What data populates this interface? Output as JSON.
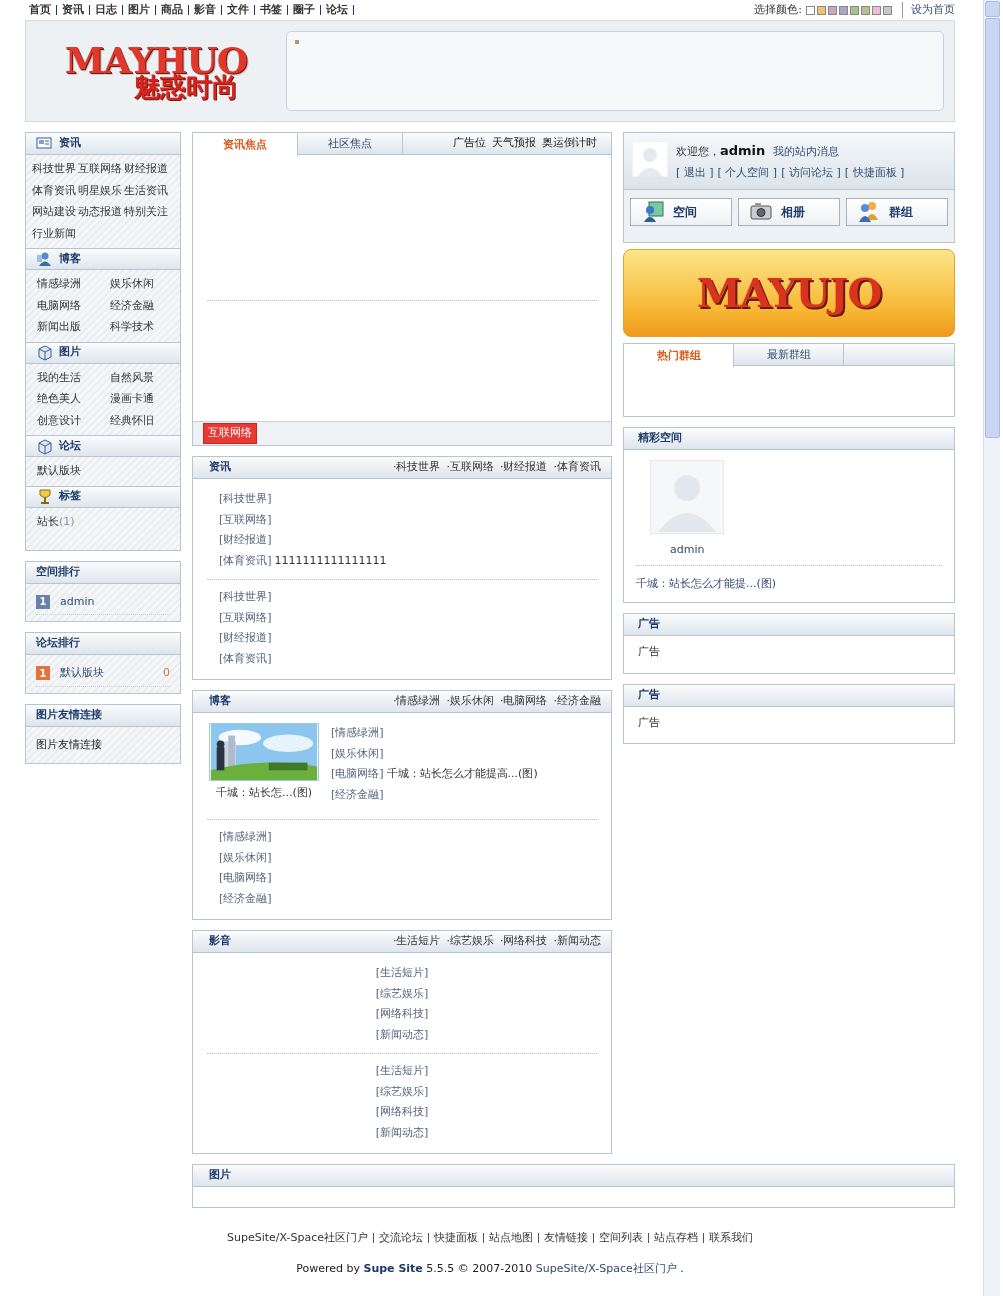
{
  "top_nav": {
    "links": [
      "首页",
      "资讯",
      "日志",
      "图片",
      "商品",
      "影音",
      "文件",
      "书签",
      "圈子",
      "论坛"
    ],
    "color_label": "选择颜色:",
    "swatches": [
      {
        "color": "#ffffff"
      },
      {
        "color": "#f4c06a"
      },
      {
        "color": "#c9a7bf"
      },
      {
        "color": "#a9a7c9"
      },
      {
        "color": "#a8c48a"
      },
      {
        "color": "#b9c08f"
      },
      {
        "color": "#f2bcd6"
      },
      {
        "color": "#c8c8c8"
      }
    ],
    "set_home": "设为首页"
  },
  "header": {
    "logo_latin": "MAYHUO",
    "logo_chinese": "魅惑时尚"
  },
  "sidebar": {
    "categories": [
      {
        "title": "资讯",
        "kind": "flow",
        "links": [
          "科技世界",
          "互联网络",
          "财经报道",
          "体育资讯",
          "明星娱乐",
          "生活资讯",
          "网站建设",
          "动态报道",
          "特别关注",
          "行业新闻"
        ]
      },
      {
        "title": "博客",
        "kind": "columns",
        "links": [
          "情感绿洲",
          "娱乐休闲",
          "电脑网络",
          "经济金融",
          "新闻出版",
          "科学技术"
        ]
      },
      {
        "title": "图片",
        "kind": "columns",
        "links": [
          "我的生活",
          "自然风景",
          "绝色美人",
          "漫画卡通",
          "创意设计",
          "经典怀旧"
        ]
      },
      {
        "title": "论坛",
        "kind": "columns",
        "links": [
          "默认版块"
        ]
      },
      {
        "title": "标签",
        "kind": "tags",
        "tags": [
          {
            "label": "站长",
            "count": "(1)"
          }
        ]
      }
    ],
    "boxes": [
      {
        "title": "空间排行",
        "items": [
          {
            "rank": "1",
            "name": "admin",
            "color": "#6b80a6"
          }
        ]
      },
      {
        "title": "论坛排行",
        "items": [
          {
            "rank": "1",
            "name": "默认版块",
            "count": "0",
            "color": "#e0743a"
          }
        ]
      },
      {
        "title": "图片友情连接",
        "text": "图片友情连接"
      }
    ]
  },
  "focus": {
    "tabs": [
      {
        "label": "资讯焦点",
        "selected": true
      },
      {
        "label": "社区焦点",
        "selected": false
      }
    ],
    "extras": [
      "广告位",
      "天气预报",
      "奥运倒计时"
    ],
    "tag": "互联网络"
  },
  "sections": [
    {
      "title": "资讯",
      "kind": "list",
      "more": [
        "·科技世界",
        "·互联网络",
        "·财经报道",
        "·体育资讯"
      ],
      "groups": [
        [
          {
            "category": "[科技世界]"
          },
          {
            "category": "[互联网络]"
          },
          {
            "category": "[财经报道]"
          },
          {
            "category": "[体育资讯]",
            "title": "1111111111111111"
          }
        ],
        [
          {
            "category": "[科技世界]"
          },
          {
            "category": "[互联网络]"
          },
          {
            "category": "[财经报道]"
          },
          {
            "category": "[体育资讯]"
          }
        ]
      ]
    },
    {
      "title": "博客",
      "kind": "featured",
      "more": [
        "·情感绿洲",
        "·娱乐休闲",
        "·电脑网络",
        "·经济金融"
      ],
      "featured": {
        "kind": "picture",
        "caption": "千城：站长怎...(图)"
      },
      "groups": [
        [
          {
            "category": "[情感绿洲]"
          },
          {
            "category": "[娱乐休闲]"
          },
          {
            "category": "[电脑网络]",
            "title": "千城：站长怎么才能提高...(图)"
          },
          {
            "category": "[经济金融]"
          }
        ],
        [
          {
            "category": "[情感绿洲]"
          },
          {
            "category": "[娱乐休闲]"
          },
          {
            "category": "[电脑网络]"
          },
          {
            "category": "[经济金融]"
          }
        ]
      ]
    },
    {
      "title": "影音",
      "kind": "centered",
      "more": [
        "·生活短片",
        "·综艺娱乐",
        "·网络科技",
        "·新闻动态"
      ],
      "groups": [
        [
          {
            "category": "[生活短片]"
          },
          {
            "category": "[综艺娱乐]"
          },
          {
            "category": "[网络科技]"
          },
          {
            "category": "[新闻动态]"
          }
        ],
        [
          {
            "category": "[生活短片]"
          },
          {
            "category": "[综艺娱乐]"
          },
          {
            "category": "[网络科技]"
          },
          {
            "category": "[新闻动态]"
          }
        ]
      ]
    },
    {
      "title": "图片"
    }
  ],
  "user_panel": {
    "welcome": "欢迎您，",
    "username": "admin",
    "messages": "我的站内消息",
    "links": [
      "[ 退出 ]",
      "[ 个人空间 ]",
      "[ 访问论坛 ]",
      "[ 快捷面板 ]"
    ],
    "buttons": [
      {
        "label": "空间"
      },
      {
        "label": "相册"
      },
      {
        "label": "群组"
      }
    ]
  },
  "banner": {
    "logo": "MAYUJO"
  },
  "group_tabs": [
    {
      "label": "热门群组",
      "selected": true
    },
    {
      "label": "最新群组",
      "selected": false
    }
  ],
  "featured_space": {
    "title": "精彩空间",
    "member": "admin",
    "post": "千城：站长怎么才能提...(图)"
  },
  "ads": [
    {
      "title": "广告",
      "body": "广告"
    },
    {
      "title": "广告",
      "body": "广告"
    }
  ],
  "footer": {
    "links": [
      "SupeSite/X-Space社区门户",
      "交流论坛",
      "快捷面板",
      "站点地图",
      "友情链接",
      "空间列表",
      "站点存档",
      "联系我们"
    ],
    "powered": "Powered by **Supe Site** 5.5.5 © 2007-2010",
    "powered_link": "SupeSite/X-Space社区门户",
    "powered_end": "."
  }
}
